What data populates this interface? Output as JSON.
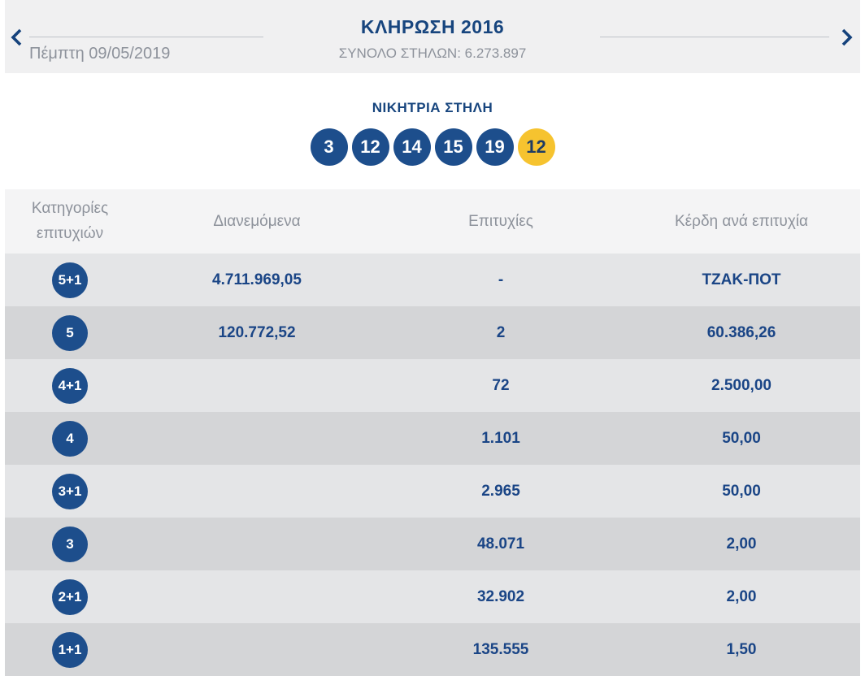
{
  "header": {
    "title": "ΚΛΗΡΩΣΗ 2016",
    "subtitle": "ΣΥΝΟΛΟ ΣΤΗΛΩΝ: 6.273.897",
    "date": "Πέμπτη 09/05/2019"
  },
  "winning_column": {
    "title": "ΝΙΚΗΤΡΙΑ ΣΤΗΛΗ",
    "numbers": [
      "3",
      "12",
      "14",
      "15",
      "19"
    ],
    "joker": "12"
  },
  "table": {
    "headers": [
      "Κατηγορίες επιτυχιών",
      "Διανεμόμενα",
      "Επιτυχίες",
      "Κέρδη ανά επιτυχία"
    ],
    "rows": [
      {
        "category": "5+1",
        "distributed": "4.711.969,05",
        "winners": "-",
        "prize": "ΤΖΑΚ-ΠΟΤ"
      },
      {
        "category": "5",
        "distributed": "120.772,52",
        "winners": "2",
        "prize": "60.386,26"
      },
      {
        "category": "4+1",
        "distributed": "",
        "winners": "72",
        "prize": "2.500,00"
      },
      {
        "category": "4",
        "distributed": "",
        "winners": "1.101",
        "prize": "50,00"
      },
      {
        "category": "3+1",
        "distributed": "",
        "winners": "2.965",
        "prize": "50,00"
      },
      {
        "category": "3",
        "distributed": "",
        "winners": "48.071",
        "prize": "2,00"
      },
      {
        "category": "2+1",
        "distributed": "",
        "winners": "32.902",
        "prize": "2,00"
      },
      {
        "category": "1+1",
        "distributed": "",
        "winners": "135.555",
        "prize": "1,50"
      }
    ]
  },
  "colors": {
    "accent_blue": "#1d4e8c",
    "navy_text": "#1a4586",
    "title_navy": "#17457e",
    "joker_yellow": "#f6c32f",
    "gray_text": "#8d929b",
    "strip_bg": "#f0f0f1",
    "table_header_bg": "#f4f4f5",
    "row_light": "#e4e5e7",
    "row_dark": "#d4d5d7"
  }
}
